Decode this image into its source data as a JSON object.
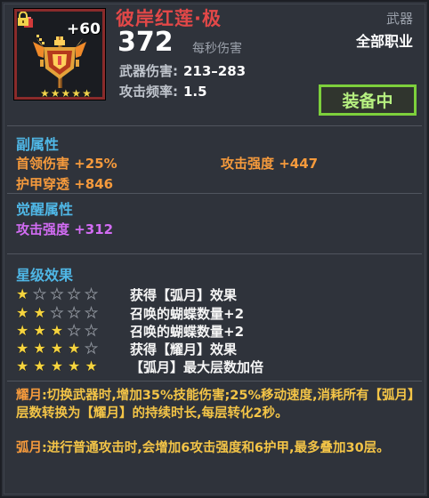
{
  "item": {
    "name": "彼岸红莲·极",
    "level": "+60",
    "stars": 5,
    "type": "武器",
    "class": "全部职业",
    "dps": "372",
    "dps_label": "每秒伤害",
    "damage_label": "武器伤害:",
    "damage_value": "213–283",
    "rate_label": "攻击频率:",
    "rate_value": "1.5",
    "status": "装备中"
  },
  "secondary": {
    "title": "副属性",
    "stats": [
      "首领伤害 +25%",
      "攻击强度 +447",
      "护甲穿透 +846"
    ]
  },
  "awaken": {
    "title": "觉醒属性",
    "stats": [
      "攻击强度 +312"
    ]
  },
  "star_effects": {
    "title": "星级效果",
    "rows": [
      {
        "stars": 1,
        "text": "获得【弧月】效果"
      },
      {
        "stars": 2,
        "text": "召唤的蝴蝶数量+2"
      },
      {
        "stars": 3,
        "text": "召唤的蝴蝶数量+2"
      },
      {
        "stars": 4,
        "text": "获得【耀月】效果"
      },
      {
        "stars": 5,
        "text": "【弧月】最大层数加倍"
      }
    ]
  },
  "descriptions": {
    "yaoyue_key": "耀月",
    "yaoyue_text": ":切换武器时,增加35%技能伤害;25%移动速度,消耗所有【弧月】层数转换为【耀月】的持续时长,每层转化2秒。",
    "huyue_key": "弧月",
    "huyue_text": ":进行普通攻击时,会增加6攻击强度和6护甲,最多叠加30层。"
  },
  "colors": {
    "title": "#e24848",
    "section": "#4fb7e6",
    "secondary_stat": "#f59a3c",
    "awaken_stat": "#d26cf3",
    "equipped_border": "#7dd03c",
    "description": "#f3c447"
  },
  "icons": {
    "weapon": "ornate-staff-icon",
    "lock": "lock-icon",
    "star": "star-icon"
  }
}
